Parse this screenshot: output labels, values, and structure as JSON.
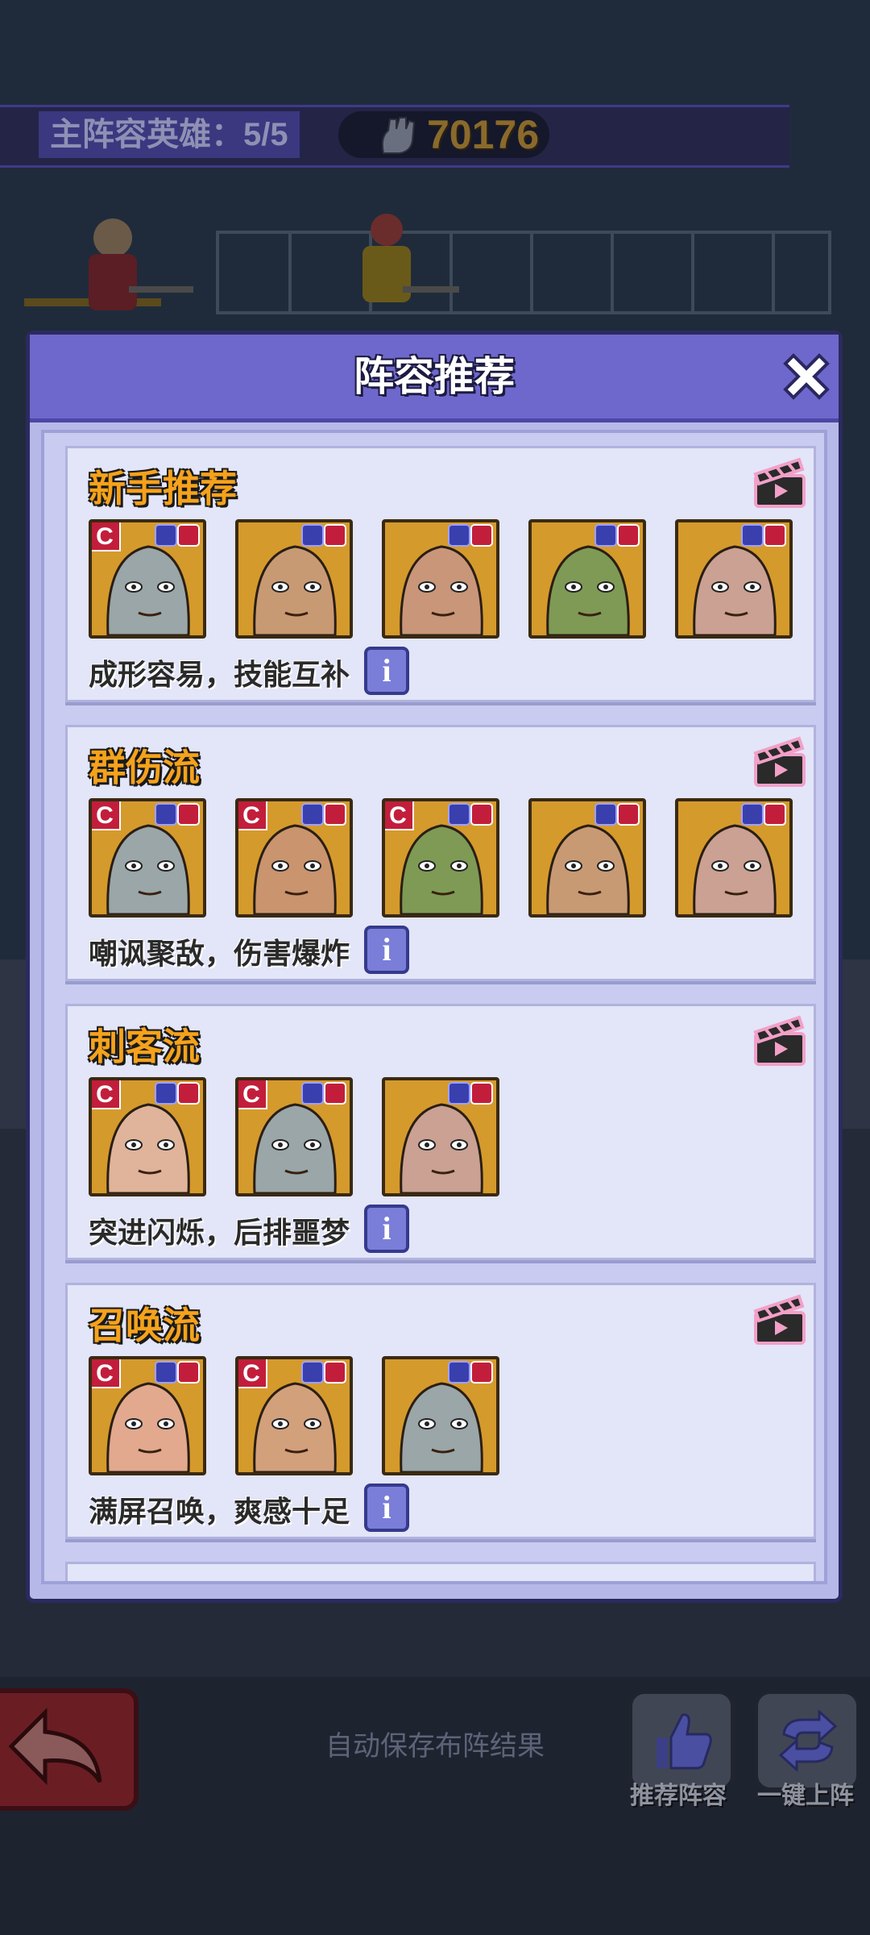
{
  "hud": {
    "main_lineup_label": "主阵容英雄：5/5",
    "power_value": "70176"
  },
  "modal": {
    "title": "阵容推荐",
    "cards": [
      {
        "title": "新手推荐",
        "description": "成形容易，技能互补",
        "heroes": [
          {
            "rarity": "C",
            "color": "#d59a2c",
            "skin": "#9aa6a8"
          },
          {
            "rarity": "",
            "color": "#d59a2c",
            "skin": "#c89a74"
          },
          {
            "rarity": "",
            "color": "#d59a2c",
            "skin": "#c9967a"
          },
          {
            "rarity": "",
            "color": "#d59a2c",
            "skin": "#7e9a55"
          },
          {
            "rarity": "",
            "color": "#d59a2c",
            "skin": "#caa192"
          }
        ]
      },
      {
        "title": "群伤流",
        "description": "嘲讽聚敌，伤害爆炸",
        "heroes": [
          {
            "rarity": "C",
            "color": "#d59a2c",
            "skin": "#9aa6a8"
          },
          {
            "rarity": "C",
            "color": "#d59a2c",
            "skin": "#c9946e"
          },
          {
            "rarity": "C",
            "color": "#d59a2c",
            "skin": "#7e9a55"
          },
          {
            "rarity": "",
            "color": "#d59a2c",
            "skin": "#c89a74"
          },
          {
            "rarity": "",
            "color": "#d59a2c",
            "skin": "#caa192"
          }
        ]
      },
      {
        "title": "刺客流",
        "description": "突进闪烁，后排噩梦",
        "heroes": [
          {
            "rarity": "C",
            "color": "#d59a2c",
            "skin": "#e0b49a"
          },
          {
            "rarity": "C",
            "color": "#d59a2c",
            "skin": "#9aa6a8"
          },
          {
            "rarity": "",
            "color": "#d59a2c",
            "skin": "#caa192"
          }
        ]
      },
      {
        "title": "召唤流",
        "description": "满屏召唤，爽感十足",
        "heroes": [
          {
            "rarity": "C",
            "color": "#d59a2c",
            "skin": "#e2a98e"
          },
          {
            "rarity": "C",
            "color": "#d59a2c",
            "skin": "#d3a07c"
          },
          {
            "rarity": "",
            "color": "#d59a2c",
            "skin": "#9aa6a8"
          }
        ]
      }
    ]
  },
  "bottom": {
    "autosave_text": "自动保存布阵结果",
    "recommend_label": "推荐阵容",
    "auto_deploy_label": "一键上阵"
  },
  "colors": {
    "modal_header": "#6f68cc",
    "card_title": "#f5a21c",
    "rarity_badge": "#c21e3c"
  }
}
